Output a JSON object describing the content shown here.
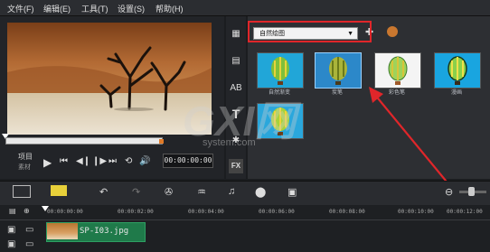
{
  "menu": {
    "file": "文件(F)",
    "edit": "编辑(E)",
    "tools": "工具(T)",
    "settings": "设置(S)",
    "help": "帮助(H)"
  },
  "player": {
    "mode_project": "项目",
    "mode_clip": "素材",
    "timecode": "00:00:00:00"
  },
  "library": {
    "category_value": "自然绘图",
    "thumbnails": [
      {
        "label": "自然渐变"
      },
      {
        "label": "炭笔"
      },
      {
        "label": "彩色笔"
      },
      {
        "label": "漫画"
      },
      {
        "label": ""
      }
    ]
  },
  "timeline": {
    "ruler_ticks": [
      "00:00:00:00",
      "00:00:02:00",
      "00:00:04:00",
      "00:00:06:00",
      "00:00:08:00",
      "00:00:10:00",
      "00:00:12:00"
    ],
    "clip_label": "SP-I03.jpg"
  },
  "watermark": {
    "brand": "GXI网",
    "url": "system.com"
  },
  "colors": {
    "annotation": "#e0262a",
    "clip": "#1f7a4a",
    "trim": "#e07a28"
  },
  "icons": [
    "import-icon",
    "text-icon",
    "fx-icon",
    "play-icon",
    "stop-icon",
    "undo-icon",
    "redo-icon",
    "zoom-out-icon"
  ]
}
